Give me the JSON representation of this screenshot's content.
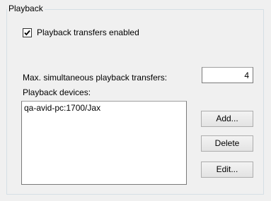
{
  "group": {
    "title": "Playback"
  },
  "checkbox": {
    "label": "Playback transfers enabled",
    "checked": true
  },
  "max_transfers": {
    "label": "Max. simultaneous playback transfers:",
    "value": "4"
  },
  "devices": {
    "label": "Playback devices:",
    "items": [
      "qa-avid-pc:1700/Jax"
    ]
  },
  "buttons": {
    "add": "Add...",
    "delete": "Delete",
    "edit": "Edit..."
  }
}
